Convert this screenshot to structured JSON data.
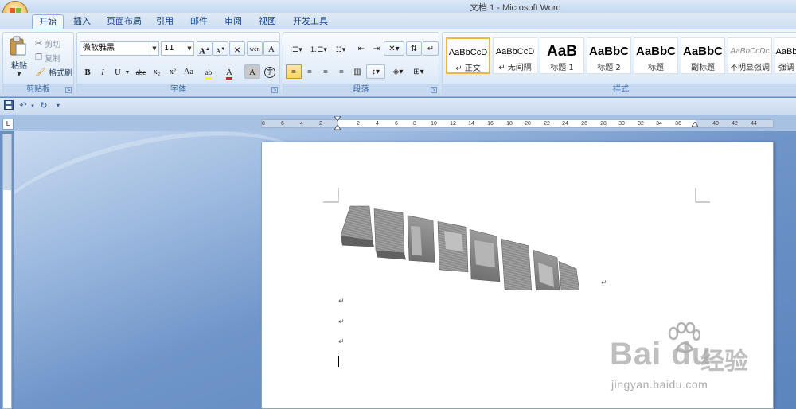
{
  "window": {
    "title": "文档 1 - Microsoft Word"
  },
  "tabs": [
    {
      "label": "开始",
      "active": true
    },
    {
      "label": "插入"
    },
    {
      "label": "页面布局"
    },
    {
      "label": "引用"
    },
    {
      "label": "邮件"
    },
    {
      "label": "审阅"
    },
    {
      "label": "视图"
    },
    {
      "label": "开发工具"
    }
  ],
  "clipboard": {
    "paste_label": "粘贴",
    "cut_label": "剪切",
    "copy_label": "复制",
    "format_painter_label": "格式刷",
    "group_label": "剪贴板"
  },
  "font": {
    "family_value": "微软雅黑",
    "size_value": "11",
    "group_label": "字体",
    "bold": "B",
    "italic": "I",
    "underline": "U",
    "strike": "abe",
    "subscript": "x₂",
    "superscript": "x²",
    "change_case": "Aa",
    "grow": "A",
    "shrink": "A",
    "phonetic": "wén",
    "char_border": "A",
    "highlight": "ab",
    "color": "A",
    "char_shade": "A",
    "enclose": "字"
  },
  "paragraph": {
    "group_label": "段落"
  },
  "styles": {
    "group_label": "样式",
    "items": [
      {
        "sample": "AaBbCcD",
        "name": "↵ 正文"
      },
      {
        "sample": "AaBbCcD",
        "name": "↵ 无间隔"
      },
      {
        "sample": "AaB",
        "name": "标题 1"
      },
      {
        "sample": "AaBbC",
        "name": "标题 2"
      },
      {
        "sample": "AaBbC",
        "name": "标题"
      },
      {
        "sample": "AaBbC",
        "name": "副标题"
      },
      {
        "sample": "AaBbCcDc",
        "name": "不明显强调"
      },
      {
        "sample": "AaBb",
        "name": "强调"
      }
    ]
  },
  "ruler": {
    "left_ticks": [
      "8",
      "6",
      "4",
      "2"
    ],
    "right_ticks": [
      "2",
      "4",
      "6",
      "8",
      "10",
      "12",
      "14",
      "16",
      "18",
      "20",
      "22",
      "24",
      "26",
      "28",
      "30",
      "32",
      "34",
      "36",
      "40",
      "42",
      "44"
    ]
  },
  "document": {
    "para_marks": [
      "↵",
      "↵",
      "↵",
      "↵"
    ]
  },
  "watermark": {
    "brand": "Bai du",
    "cn": "经验",
    "url": "jingyan.baidu.com"
  },
  "colors": {
    "accent": "#15428b",
    "workspace": "#6f95c9",
    "selected_style_border": "#f0b63a"
  }
}
